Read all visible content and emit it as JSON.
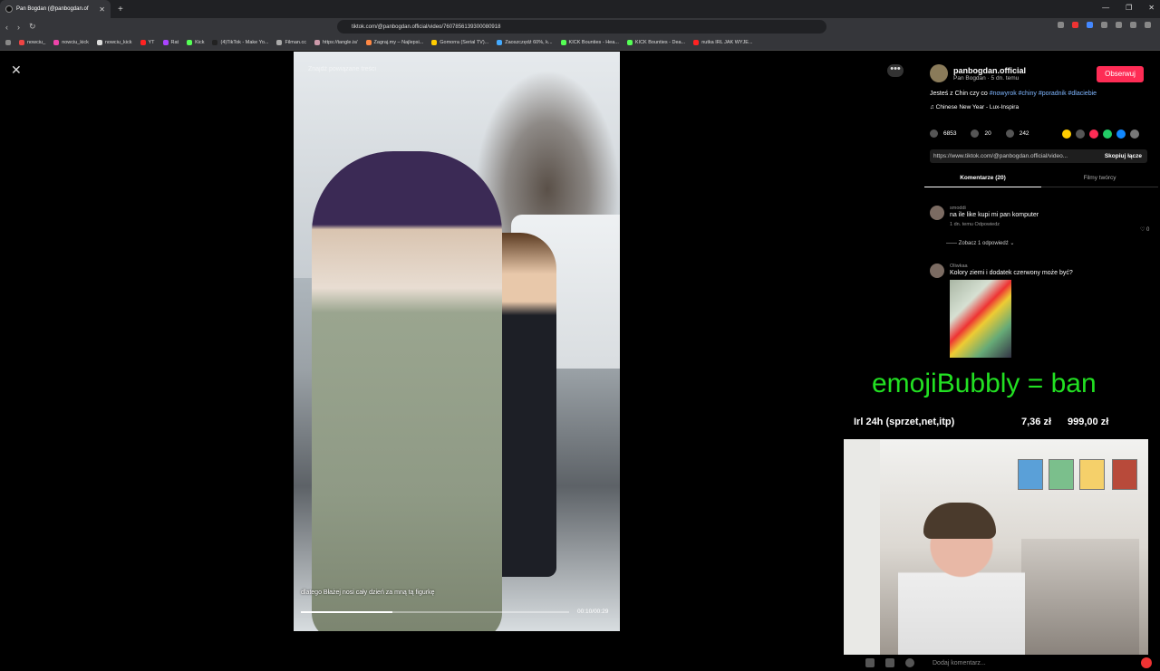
{
  "browser": {
    "tab_title": "Pan Bogdan (@panbogdan.of",
    "url": "tiktok.com/@panbogdan.official/video/7607856139300080918",
    "bookmarks": [
      "nowciu_",
      "nowciu_kick",
      "nowciu_kick",
      "YT",
      "Rat",
      "Kick",
      "(4)TikTok - Make Yo...",
      "Filman.cc",
      "https://tangle.is/",
      "Zagraj.my – Najlepsi...",
      "Gomorra (Serial TV)...",
      "Zaoszczędź 60%, k...",
      "KICK Bounties - Hea...",
      "KICK Bounties - Dea...",
      "nutka IRL JAK WYJE..."
    ]
  },
  "video": {
    "search_hint": "Znajdź powiązane treści",
    "caption": "dlatego Błażej nosi cały dzień za mną tą figurkę",
    "time": "00:10/00:29",
    "progress_fraction": 0.34
  },
  "panel": {
    "username": "panbogdan.official",
    "subline": "Pan Bogdan · 5 dn. temu",
    "follow_label": "Obserwuj",
    "desc_text": "Jesteś z Chin czy co ",
    "desc_tags": "#nowyrok #chiny #poradnik #dlaciebie",
    "song": "♫ Chinese New Year - Lux-Inspira",
    "likes": "6853",
    "comments": "20",
    "saves": "242",
    "link": "https://www.tiktok.com/@panbogdan.official/video...",
    "copy_label": "Skopiuj łącze",
    "tab_comments": "Komentarze (20)",
    "tab_creator": "Filmy twórcy",
    "comment1_user": "smoddi",
    "comment1_text": "na ile like kupi mi pan komputer",
    "comment1_meta": "1 dn. temu   Odpowiedz",
    "comment1_likes": "♡ 0",
    "more_replies": "——  Zobacz 1 odpowiedź ⌄",
    "comment2_user": "Oliwkaa",
    "comment2_text": "Kolory ziemi i dodatek czerwony może być?",
    "add_comment": "Dodaj komentarz..."
  },
  "overlay": {
    "banner": "emojiBubbly = ban",
    "goal_label": "Irl 24h (sprzet,net,itp)",
    "goal_amount": "7,36 zł",
    "goal_target": "999,00 zł"
  },
  "colors": {
    "accent": "#fe2c55",
    "overlay_green": "#22e022",
    "hashtag": "#7fb6ff"
  }
}
